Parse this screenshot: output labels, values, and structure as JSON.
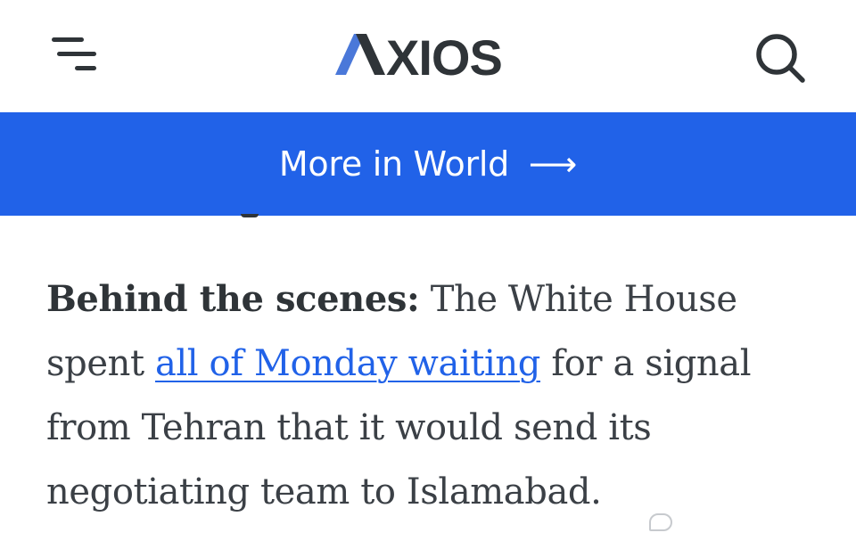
{
  "header": {
    "logo_text": "AXIOS",
    "menu_icon": "hamburger-menu-icon",
    "search_icon": "search-icon"
  },
  "banner": {
    "label": "More in World",
    "arrow": "⟶"
  },
  "article": {
    "lead": "Behind the scenes:",
    "text_before_link": " The White House spent ",
    "link_text": "all of Monday waiting",
    "text_after_link": " for a signal from Tehran that it would send its negotiating team to Islamabad."
  },
  "colors": {
    "brand_blue": "#2162e8",
    "text_dark": "#2f3438",
    "body_text": "#3b4046"
  }
}
